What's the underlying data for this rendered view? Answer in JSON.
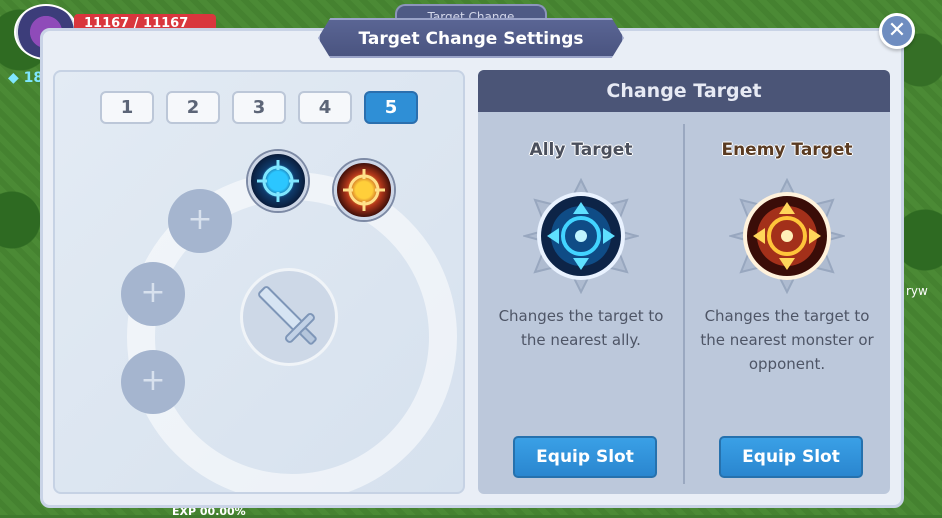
{
  "hud": {
    "hp": "11167 / 11167",
    "gem": "18",
    "exp": "EXP 00.00%",
    "side_name": "ryw"
  },
  "dialog": {
    "tab_label": "Target Change",
    "title": "Target Change Settings",
    "close_symbol": "✕"
  },
  "slots": {
    "tabs": [
      "1",
      "2",
      "3",
      "4",
      "5"
    ],
    "active_tab": "5",
    "empty_symbol": "+"
  },
  "change_target": {
    "header": "Change Target",
    "ally": {
      "title": "Ally Target",
      "description": "Changes the target to the nearest ally.",
      "button": "Equip Slot",
      "title_color": "#4a4f5c",
      "icon_color": "#29b6f0"
    },
    "enemy": {
      "title": "Enemy Target",
      "description": "Changes the target to the nearest monster or opponent.",
      "button": "Equip Slot",
      "title_color": "#5a3b22",
      "icon_color": "#f0a21c"
    }
  },
  "colors": {
    "accent_blue": "#2f8fd6",
    "panel_header": "#4b5577"
  }
}
